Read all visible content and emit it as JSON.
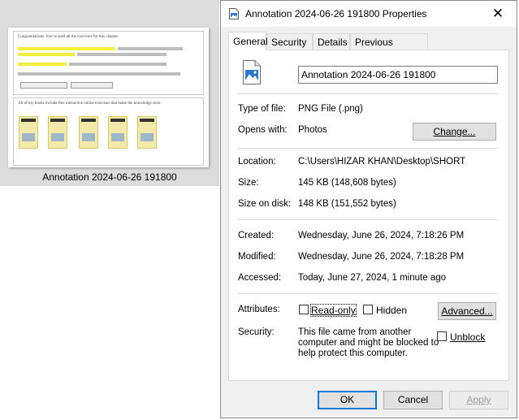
{
  "thumbnail": {
    "caption": "Annotation 2024-06-26 191800",
    "heading_text": "Congratulations. You've aced all the exercises for this chapter.",
    "section_text": "All of my books include free interactive online exercises that make the knowledge stick."
  },
  "dialog": {
    "title": "Annotation 2024-06-26 191800 Properties",
    "close_glyph": "✕",
    "tabs": [
      {
        "label": "General"
      },
      {
        "label": "Security"
      },
      {
        "label": "Details"
      },
      {
        "label": "Previous Versions"
      }
    ],
    "filename": "Annotation 2024-06-26 191800",
    "type_of_file": {
      "label": "Type of file:",
      "value": "PNG File (.png)"
    },
    "opens_with": {
      "label": "Opens with:",
      "value": "Photos",
      "button": "Change..."
    },
    "location": {
      "label": "Location:",
      "value": "C:\\Users\\HIZAR KHAN\\Desktop\\SHORT"
    },
    "size": {
      "label": "Size:",
      "value": "145 KB (148,608 bytes)"
    },
    "size_on_disk": {
      "label": "Size on disk:",
      "value": "148 KB (151,552 bytes)"
    },
    "created": {
      "label": "Created:",
      "value": "Wednesday, June 26, 2024, 7:18:26 PM"
    },
    "modified": {
      "label": "Modified:",
      "value": "Wednesday, June 26, 2024, 7:18:28 PM"
    },
    "accessed": {
      "label": "Accessed:",
      "value": "Today, June 27, 2024, 1 minute ago"
    },
    "attributes": {
      "label": "Attributes:",
      "read_only": "Read-only",
      "hidden": "Hidden",
      "advanced": "Advanced..."
    },
    "security": {
      "label": "Security:",
      "line1": "This file came from another",
      "line2": "computer and might be blocked to",
      "line3": "help protect this computer.",
      "unblock": "Unblock"
    },
    "buttons": {
      "ok": "OK",
      "cancel": "Cancel",
      "apply": "Apply"
    }
  },
  "colors": {
    "accent": "#0078d7",
    "thumbnail_highlight": "#f2ef3a",
    "book_cover": "#f3e9a8"
  },
  "icons": [
    "png-file-icon",
    "close-icon",
    "checkbox-icon"
  ]
}
